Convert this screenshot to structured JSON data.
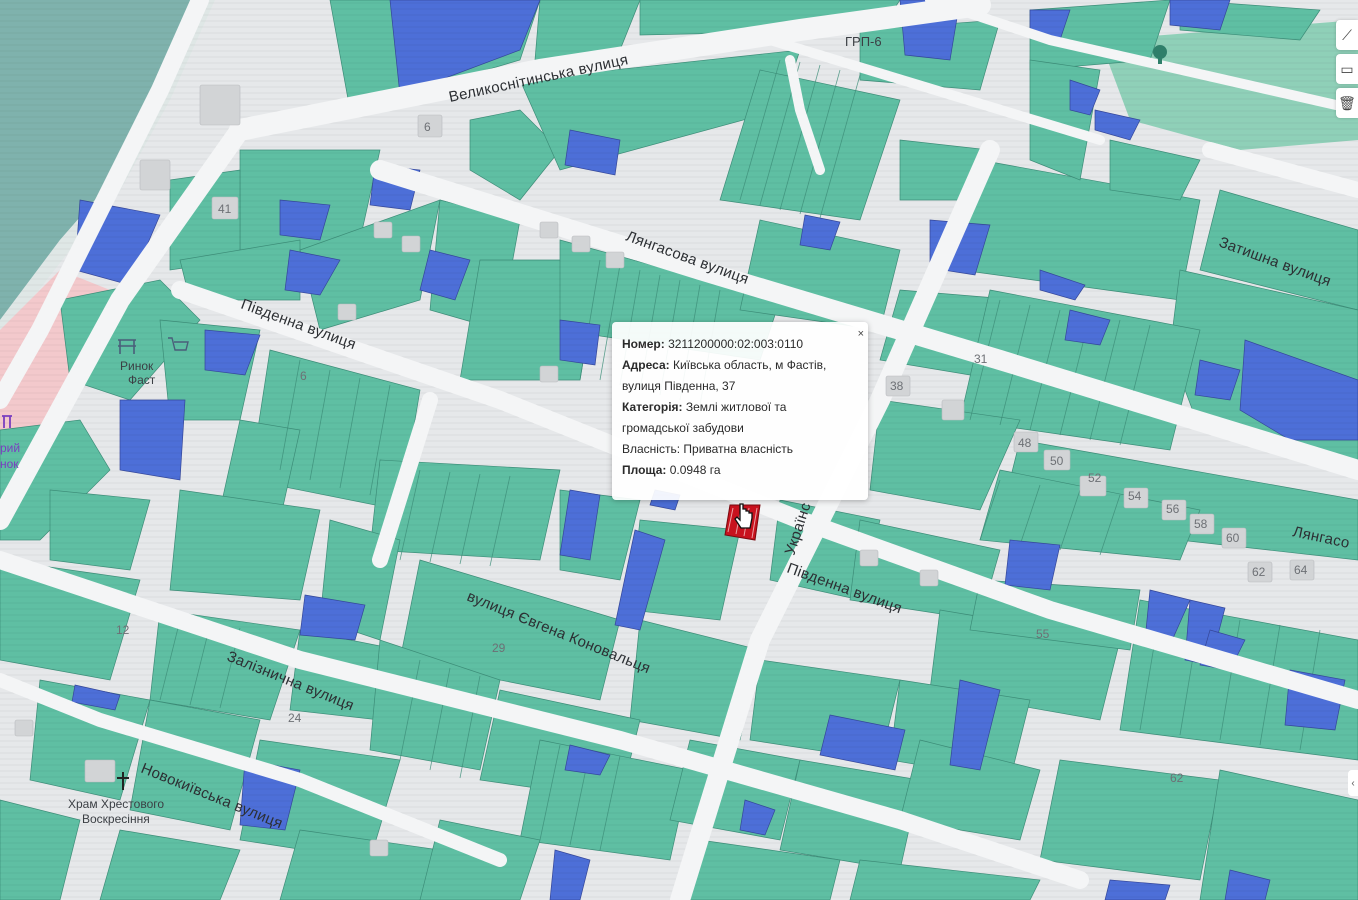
{
  "map": {
    "streets": [
      {
        "id": "velykosnitynska",
        "label": "Великоснітинська вулиця"
      },
      {
        "id": "liangasova-1",
        "label": "Лянгасова вулиця"
      },
      {
        "id": "pivdenna-1",
        "label": "Південна вулиця"
      },
      {
        "id": "zatyshna",
        "label": "Затишна вулиця"
      },
      {
        "id": "pivdenna-2",
        "label": "Південна вулиця"
      },
      {
        "id": "ukrainska",
        "label": "Українс"
      },
      {
        "id": "konovaltsia",
        "label": "вулиця Євгена Коновальця"
      },
      {
        "id": "zaliznychna",
        "label": "Залізнична вулиця"
      },
      {
        "id": "novokyivska",
        "label": "Новокиївська вулиця"
      },
      {
        "id": "liangasova-2",
        "label": "Лянгасо"
      }
    ],
    "house_numbers": [
      "6",
      "41",
      "31",
      "38",
      "48",
      "50",
      "52",
      "54",
      "56",
      "58",
      "60",
      "62",
      "64",
      "55",
      "24",
      "12",
      "29",
      "6",
      "62"
    ],
    "pois": {
      "grp": "ГРП-6",
      "market": [
        "Ринок",
        "Фаст"
      ],
      "market2": [
        "рий",
        "нок"
      ],
      "church": [
        "Храм Хрестового",
        "Воскресіння"
      ]
    },
    "colors": {
      "parcel_green": "#5fbfa3",
      "parcel_blue": "#4d6fd8",
      "selected_parcel": "#c8121e",
      "water": "#7fb0b0"
    }
  },
  "popup": {
    "number_label": "Номер:",
    "number_value": "3211200000:02:003:0110",
    "address_label": "Адреса:",
    "address_value_1": "Київська область, м Фастів,",
    "address_value_2": "вулиця Південна, 37",
    "category_label": "Категорія:",
    "category_value_1": "Землі житлової та",
    "category_value_2": "громадської забудови",
    "ownership_label": "Власність:",
    "ownership_value": "Приватна власність",
    "area_label": "Площа:",
    "area_value": "0.0948 га",
    "close": "×"
  },
  "controls": {
    "line_tool_icon": "polyline-icon",
    "polygon_tool_icon": "polygon-icon",
    "trash_icon": "trash-icon"
  }
}
